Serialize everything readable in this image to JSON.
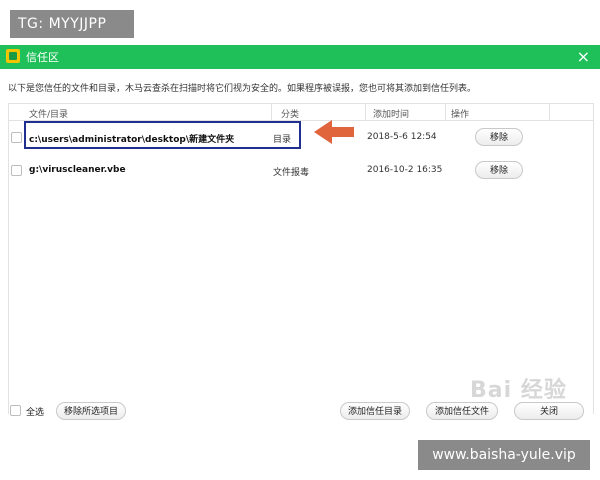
{
  "overlay": {
    "tg_label": "TG: MYYJJPP",
    "url_label": "www.baisha-yule.vip",
    "watermark": "Bai 经验"
  },
  "window": {
    "title": "信任区",
    "close_glyph": "×",
    "description": "以下是您信任的文件和目录，木马云查杀在扫描时将它们视为安全的。如果程序被误报，您也可将其添加到信任列表。"
  },
  "table": {
    "headers": {
      "path": "文件/目录",
      "category": "分类",
      "added_time": "添加时间",
      "action": "操作"
    },
    "rows": [
      {
        "path": "c:\\users\\administrator\\desktop\\新建文件夹",
        "category": "目录",
        "added_time": "2018-5-6 12:54",
        "action": "移除"
      },
      {
        "path": "g:\\viruscleaner.vbe",
        "category": "文件报毒",
        "added_time": "2016-10-2 16:35",
        "action": "移除"
      }
    ]
  },
  "footer": {
    "select_all": "全选",
    "remove_selected": "移除所选项目",
    "add_trust_dir": "添加信任目录",
    "add_trust_file": "添加信任文件",
    "close": "关闭"
  },
  "colors": {
    "titlebar": "#1fc05a",
    "highlight": "#1f2f8f",
    "arrow": "#e0643c"
  }
}
